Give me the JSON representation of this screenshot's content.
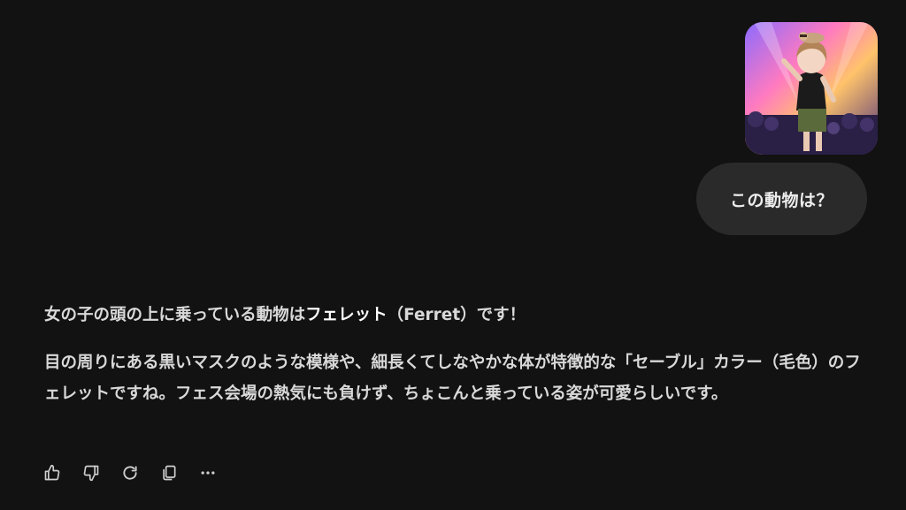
{
  "user_message": {
    "attachment_icon": "anime-concert-image",
    "text": "この動物は？"
  },
  "assistant_message": {
    "line1_prefix": "女の子の頭の上に乗っている動物は",
    "line1_strong": "フェレット",
    "line1_suffix": "（Ferret）です！",
    "paragraph2": "目の周りにある黒いマスクのような模様や、細長くてしなやかな体が特徴的な「セーブル」カラー（毛色）のフェレットですね。フェス会場の熱気にも負けず、ちょこんと乗っている姿が可愛らしいです。"
  },
  "actions": [
    {
      "name": "thumbs-up-icon"
    },
    {
      "name": "thumbs-down-icon"
    },
    {
      "name": "regenerate-icon"
    },
    {
      "name": "copy-icon"
    },
    {
      "name": "more-icon"
    }
  ],
  "colors": {
    "background": "#121212",
    "bubble": "#2a2a2a",
    "text": "#d9d9d9"
  }
}
